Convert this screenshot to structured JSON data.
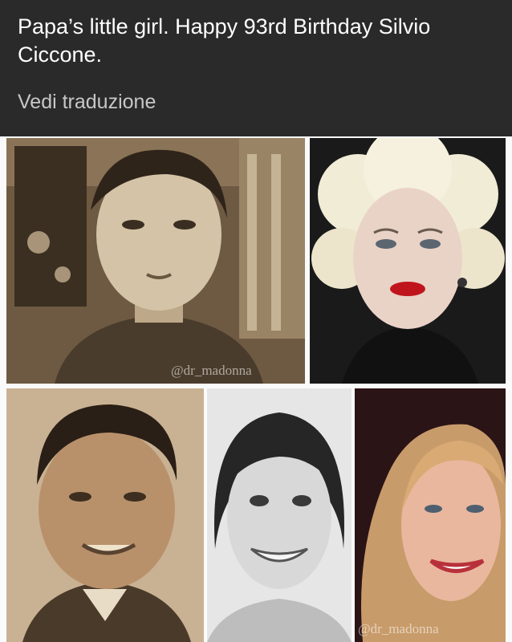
{
  "post": {
    "caption": "Papa’s little girl. Happy 93rd Birthday Silvio Ciccone.",
    "translate_label": "Vedi traduzione"
  },
  "photos": {
    "top_left": {
      "watermark": "@dr_madonna"
    },
    "bottom_right": {
      "watermark": "@dr_madonna"
    }
  },
  "colors": {
    "header_bg": "#2a2a2a",
    "caption_text": "#ffffff",
    "translate_text": "#c7c7c7",
    "sepia": "#8a7356"
  }
}
